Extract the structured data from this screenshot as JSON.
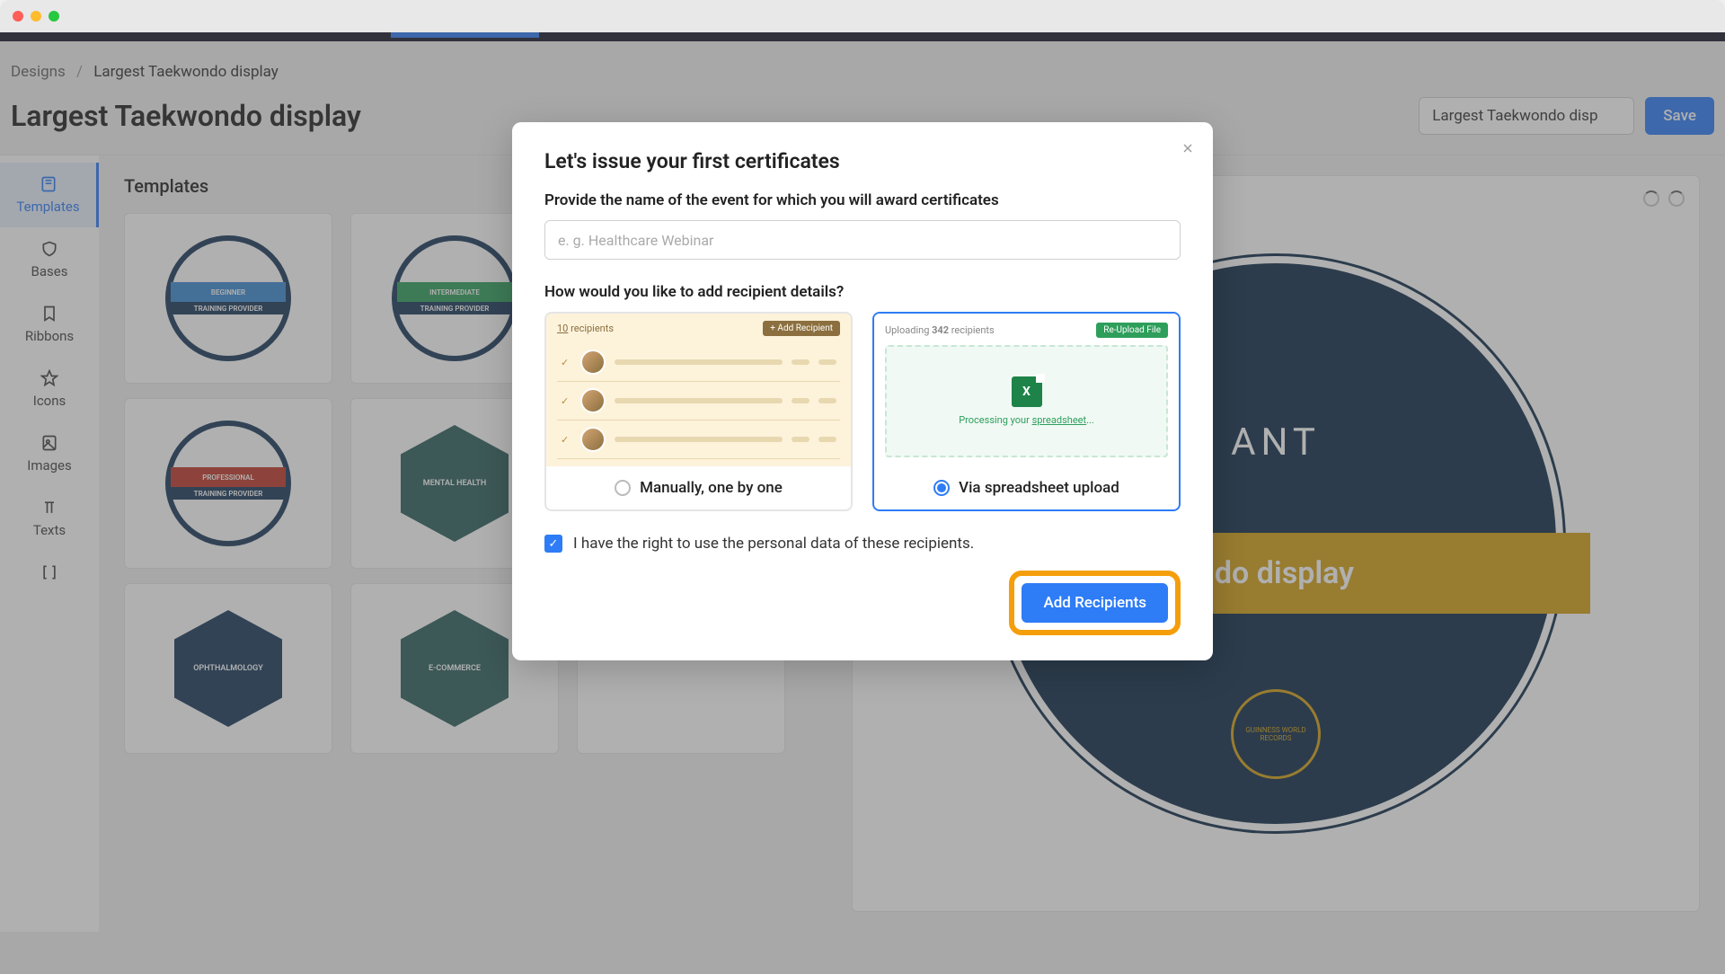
{
  "breadcrumbs": {
    "root": "Designs",
    "current": "Largest Taekwondo display"
  },
  "page": {
    "title": "Largest Taekwondo display",
    "name_input_value": "Largest Taekwondo disp",
    "save_label": "Save"
  },
  "sidebar": {
    "items": [
      {
        "label": "Templates"
      },
      {
        "label": "Bases"
      },
      {
        "label": "Ribbons"
      },
      {
        "label": "Icons"
      },
      {
        "label": "Images"
      },
      {
        "label": "Texts"
      }
    ]
  },
  "panel": {
    "title": "Templates"
  },
  "templates": [
    {
      "level": "BEGINNER",
      "main": "TRAINING PROVIDER",
      "shape": "circle",
      "accent": "blue"
    },
    {
      "level": "INTERMEDIATE",
      "main": "TRAINING PROVIDER",
      "shape": "circle",
      "accent": "green"
    },
    {
      "level": "PROFESSIONAL",
      "main": "TRAINING PROVIDER",
      "shape": "circle",
      "accent": "red"
    },
    {
      "level": "",
      "main": "MENTAL HEALTH",
      "shape": "hex",
      "accent": "teal"
    },
    {
      "level": "",
      "main": "OPHTHALMOLOGY",
      "shape": "hex",
      "accent": "blue"
    },
    {
      "level": "",
      "main": "E-COMMERCE",
      "shape": "hex",
      "accent": "teal"
    }
  ],
  "canvas_badge": {
    "top_text": "ANT",
    "ribbon_text": "ndo display",
    "seal_text": "GUINNESS WORLD RECORDS"
  },
  "modal": {
    "title": "Let's issue your first certificates",
    "event_label": "Provide the name of the event for which you will award certificates",
    "event_placeholder": "e. g. Healthcare Webinar",
    "method_label": "How would you like to add recipient details?",
    "manual": {
      "count_prefix": "10",
      "count_suffix": "recipients",
      "add_label": "+ Add Recipient",
      "radio_label": "Manually, one by one"
    },
    "sheet": {
      "uploading_prefix": "Uploading",
      "count": "342",
      "uploading_suffix": "recipients",
      "reupload_label": "Re-Upload File",
      "processing_prefix": "Processing your",
      "processing_link": "spreadsheet",
      "processing_suffix": "...",
      "radio_label": "Via spreadsheet upload"
    },
    "consent_text": "I have the right to use the personal data of these recipients.",
    "submit_label": "Add Recipients"
  }
}
